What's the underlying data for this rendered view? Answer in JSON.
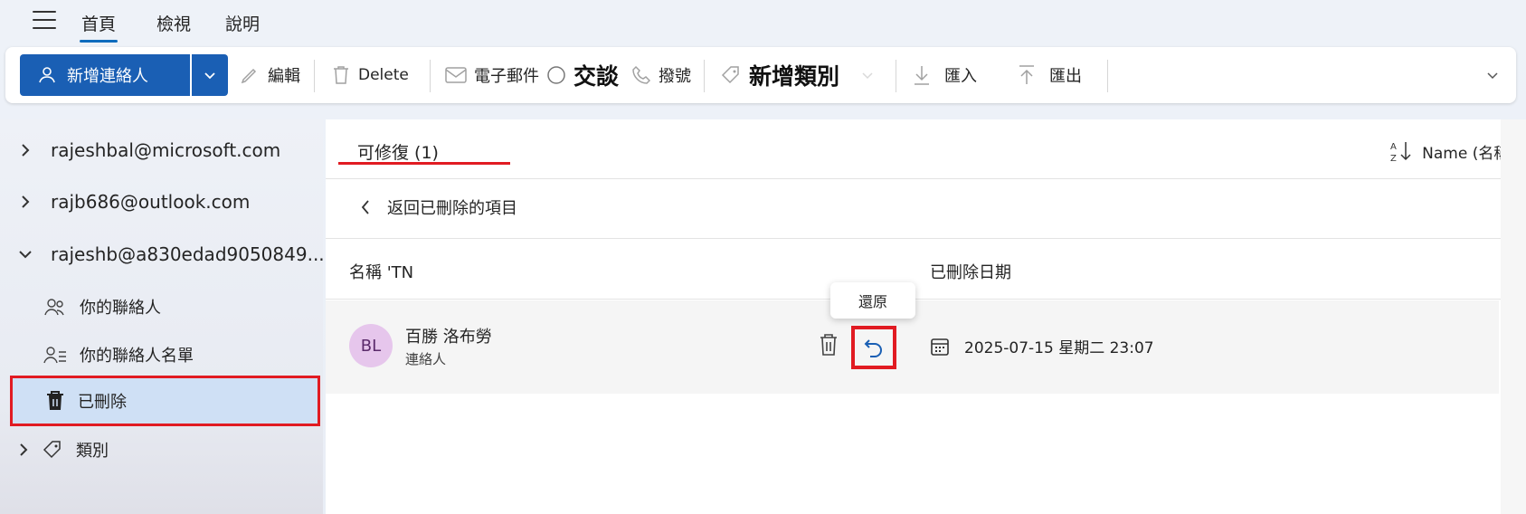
{
  "nav": {
    "tabs": [
      {
        "label": "首頁",
        "active": true
      },
      {
        "label": "檢視",
        "active": false
      },
      {
        "label": "說明",
        "active": false
      }
    ]
  },
  "ribbon": {
    "new_contact": "新增連絡人",
    "edit": "編輯",
    "delete": "Delete",
    "email": "電子郵件",
    "chat": "交談",
    "call": "撥號",
    "add_category": "新增類別",
    "import": "匯入",
    "export": "匯出"
  },
  "sidebar": {
    "accounts": [
      {
        "email": "rajeshbal@microsoft.com",
        "expanded": false
      },
      {
        "email": "rajb686@outlook.com",
        "expanded": false
      },
      {
        "email": "rajeshb@a830edad9050849...",
        "expanded": true
      }
    ],
    "items": [
      {
        "label": "你的聯絡人"
      },
      {
        "label": "你的聯絡人名單"
      },
      {
        "label": "已刪除",
        "selected": true
      },
      {
        "label": "類別"
      }
    ]
  },
  "main": {
    "tab_label": "可修復 (1)",
    "sort_label": "Name (名稱)",
    "back_label": "返回已刪除的項目",
    "col_name": "名稱 'TN",
    "col_deleted": "已刪除日期",
    "tooltip": "還原",
    "rows": [
      {
        "initials": "BL",
        "name": "百勝 洛布勞",
        "type": "連絡人",
        "deleted_date": "2025-07-15 星期二 23:07"
      }
    ]
  },
  "colors": {
    "accent": "#1a5fb4",
    "highlight": "#e11b22",
    "selected_bg": "#cfe0f5",
    "avatar_bg": "#e6c6ec"
  }
}
